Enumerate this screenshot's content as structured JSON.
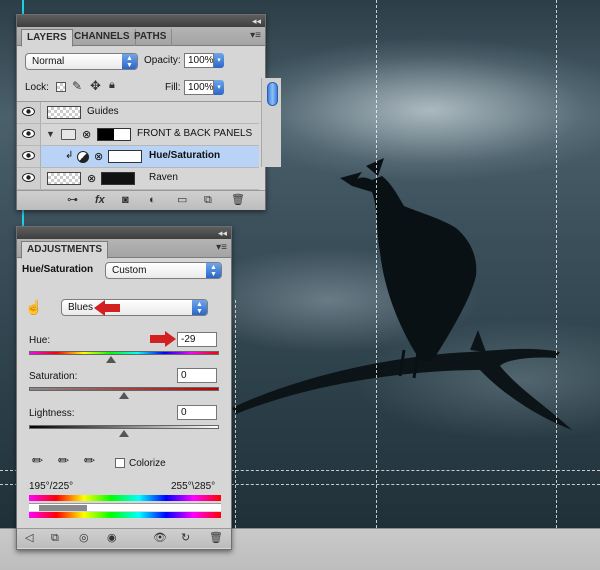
{
  "layers_panel": {
    "tabs": [
      {
        "label": "LAYERS"
      },
      {
        "label": "CHANNELS"
      },
      {
        "label": "PATHS"
      }
    ],
    "blend_mode": "Normal",
    "opacity_label": "Opacity:",
    "opacity_value": "100%",
    "lock_label": "Lock:",
    "fill_label": "Fill:",
    "fill_value": "100%",
    "layers": [
      {
        "name": "Guides"
      },
      {
        "name": "FRONT & BACK PANELS"
      },
      {
        "name": "Hue/Saturation"
      },
      {
        "name": "Raven"
      }
    ],
    "bottom_icons": [
      "link-icon",
      "fx-icon",
      "mask-icon",
      "adjustment-icon",
      "folder-icon",
      "new-layer-icon",
      "trash-icon"
    ]
  },
  "adjustments_panel": {
    "tab": "ADJUSTMENTS",
    "title": "Hue/Saturation",
    "preset": "Custom",
    "channel": "Blues",
    "hue_label": "Hue:",
    "hue_value": "-29",
    "hue_level": 0.43,
    "saturation_label": "Saturation:",
    "saturation_value": "0",
    "saturation_level": 0.5,
    "lightness_label": "Lightness:",
    "lightness_value": "0",
    "lightness_level": 0.5,
    "colorize_label": "Colorize",
    "range_left": "195°/225°",
    "range_right": "255°\\285°",
    "bottom_icons": [
      "back-icon",
      "clip-icon",
      "visibility-icon",
      "eye-icon",
      "reset-icon",
      "undo-icon",
      "trash-icon"
    ]
  },
  "colors": {
    "selection": "#b8d3f5",
    "accent": "#2a66c8",
    "annotation_arrow": "#d32020",
    "guide_line": "#1fd0e0"
  }
}
